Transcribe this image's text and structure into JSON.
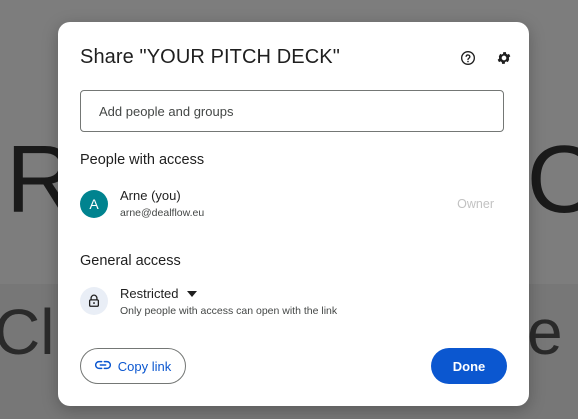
{
  "background": {
    "letters": [
      "R",
      "O",
      "Cli",
      "e"
    ]
  },
  "dialog": {
    "title": "Share \"YOUR PITCH DECK\"",
    "help_icon": "help-circle-icon",
    "settings_icon": "gear-icon"
  },
  "search": {
    "placeholder": "Add people and groups",
    "value": ""
  },
  "people_section": {
    "title": "People with access",
    "people": [
      {
        "avatar_initial": "A",
        "name": "Arne (you)",
        "email": "arne@dealflow.eu",
        "role": "Owner"
      }
    ]
  },
  "general_access": {
    "title": "General access",
    "level": "Restricted",
    "description": "Only people with access can open with the link"
  },
  "footer": {
    "copy_link_label": "Copy link",
    "done_label": "Done"
  },
  "colors": {
    "accent": "#0b57d0",
    "avatar": "#00838f",
    "owner_text": "#c2c2c2"
  }
}
